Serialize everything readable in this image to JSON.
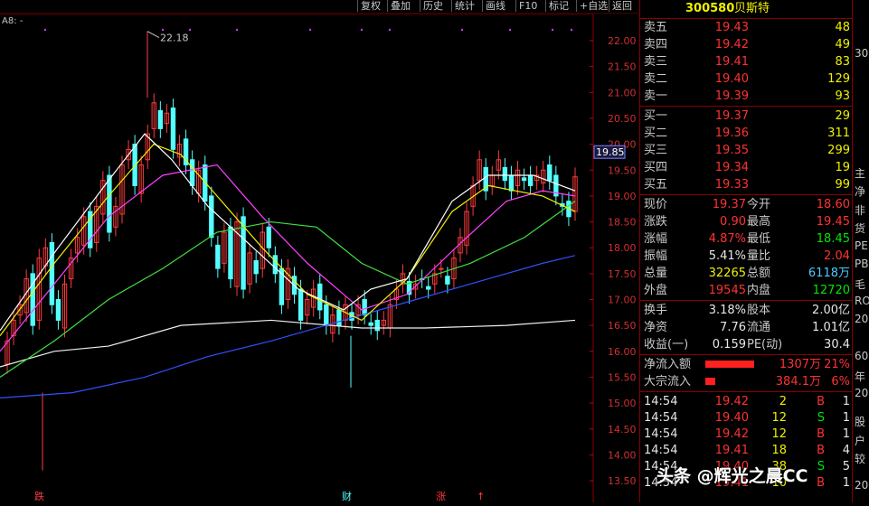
{
  "toolbar": {
    "items": [
      "复权",
      "叠加",
      "历史",
      "统计",
      "画线",
      "F10",
      "标记",
      "+自选",
      "返回"
    ]
  },
  "chart": {
    "indicator_label": "A8: -",
    "high_label": "22.18",
    "price_ticks": [
      "22.00",
      "21.50",
      "21.00",
      "20.50",
      "20.00",
      "19.50",
      "19.00",
      "18.50",
      "18.00",
      "17.50",
      "17.00",
      "16.50",
      "16.00",
      "15.50",
      "15.00",
      "14.50",
      "14.00",
      "13.50"
    ],
    "current_price_box": "19.85",
    "bottom_markers": [
      "跌",
      "财",
      "涨",
      "↑"
    ]
  },
  "quote": {
    "code": "300580",
    "name": "贝斯特",
    "asks": [
      {
        "label": "卖五",
        "price": "19.43",
        "vol": "48"
      },
      {
        "label": "卖四",
        "price": "19.42",
        "vol": "49"
      },
      {
        "label": "卖三",
        "price": "19.41",
        "vol": "83"
      },
      {
        "label": "卖二",
        "price": "19.40",
        "vol": "129"
      },
      {
        "label": "卖一",
        "price": "19.39",
        "vol": "93"
      }
    ],
    "bids": [
      {
        "label": "买一",
        "price": "19.37",
        "vol": "29"
      },
      {
        "label": "买二",
        "price": "19.36",
        "vol": "311"
      },
      {
        "label": "买三",
        "price": "19.35",
        "vol": "299"
      },
      {
        "label": "买四",
        "price": "19.34",
        "vol": "19"
      },
      {
        "label": "买五",
        "price": "19.33",
        "vol": "99"
      }
    ],
    "stats": [
      {
        "l1": "现价",
        "v1": "19.37",
        "c1": "red",
        "l2": "今开",
        "v2": "18.60",
        "c2": "red"
      },
      {
        "l1": "涨跌",
        "v1": "0.90",
        "c1": "red",
        "l2": "最高",
        "v2": "19.45",
        "c2": "red"
      },
      {
        "l1": "涨幅",
        "v1": "4.87%",
        "c1": "red",
        "l2": "最低",
        "v2": "18.45",
        "c2": "green"
      },
      {
        "l1": "振幅",
        "v1": "5.41%",
        "c1": "white",
        "l2": "量比",
        "v2": "2.04",
        "c2": "red"
      },
      {
        "l1": "总量",
        "v1": "32265",
        "c1": "yellow",
        "l2": "总额",
        "v2": "6118万",
        "c2": "cyan"
      },
      {
        "l1": "外盘",
        "v1": "19545",
        "c1": "red",
        "l2": "内盘",
        "v2": "12720",
        "c2": "green"
      }
    ],
    "fund": [
      {
        "l1": "换手",
        "v1": "3.18%",
        "l2": "股本",
        "v2": "2.00亿"
      },
      {
        "l1": "净资",
        "v1": "7.76",
        "l2": "流通",
        "v2": "1.01亿"
      },
      {
        "l1": "收益(一)",
        "v1": "0.159",
        "l2": "PE(动)",
        "v2": "30.4"
      }
    ],
    "flow": [
      {
        "label": "净流入额",
        "value": "1307万",
        "pct": "21%",
        "bar": 0.9
      },
      {
        "label": "大宗流入",
        "value": "384.1万",
        "pct": "6%",
        "bar": 0.18
      }
    ],
    "ticks": [
      {
        "time": "14:54",
        "price": "19.42",
        "vol": "2",
        "side": "B",
        "n": "1"
      },
      {
        "time": "14:54",
        "price": "19.40",
        "vol": "12",
        "side": "S",
        "n": "1"
      },
      {
        "time": "14:54",
        "price": "19.42",
        "vol": "12",
        "side": "B",
        "n": "1"
      },
      {
        "time": "14:54",
        "price": "19.41",
        "vol": "18",
        "side": "B",
        "n": "4"
      },
      {
        "time": "14:54",
        "price": "19.40",
        "vol": "38",
        "side": "S",
        "n": "5"
      },
      {
        "time": "14:54",
        "price": "19.41",
        "vol": "10",
        "side": "B",
        "n": "1"
      }
    ]
  },
  "far_panel": {
    "labels": [
      "30",
      "主",
      "净",
      "非",
      "货",
      "PE",
      "PB",
      "毛",
      "RO",
      "20",
      "60",
      "年",
      "20",
      "股",
      "户",
      "较",
      "20"
    ]
  },
  "watermark": "头条 @辉光之晨CC"
}
